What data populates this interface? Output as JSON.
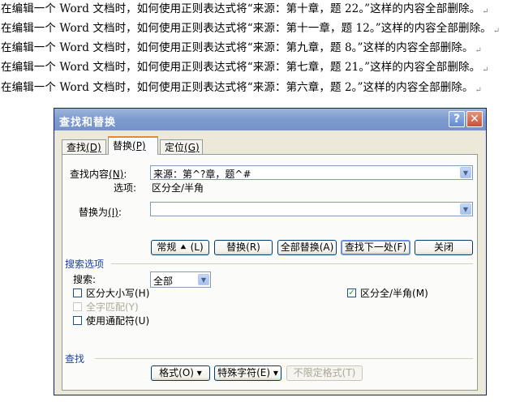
{
  "document": {
    "lines": [
      "在编辑一个 Word 文档时，如何使用正则表达式将“来源：第十章，题 22。”这样的内容全部删除。",
      "在编辑一个 Word 文档时，如何使用正则表达式将“来源：第十一章，题 12。”这样的内容全部删除。",
      "在编辑一个 Word 文档时，如何使用正则表达式将“来源：第九章，题 8。”这样的内容全部删除。",
      "在编辑一个 Word 文档时，如何使用正则表达式将“来源：第七章，题 21。”这样的内容全部删除。",
      "在编辑一个 Word 文档时，如何使用正则表达式将“来源：第六章，题 2。”这样的内容全部删除。"
    ],
    "paragraph_mark": "↵"
  },
  "dialog": {
    "title": "查找和替换",
    "help_glyph": "?",
    "close_glyph": "✕",
    "tabs": [
      {
        "label": "查找",
        "key": "(D)"
      },
      {
        "label": "替换",
        "key": "(P)"
      },
      {
        "label": "定位",
        "key": "(G)"
      }
    ],
    "find_label": "查找内容",
    "find_key": "(N)",
    "colon": ":",
    "find_value": "来源：第^?章，题^#",
    "options_label": "选项:",
    "options_value": "区分全/半角",
    "replace_label": "替换为",
    "replace_key": "(I)",
    "replace_value": "",
    "buttons": {
      "less": "常规 ⯅ (L)",
      "replace": "替换(R)",
      "replace_all": "全部替换(A)",
      "find_next": "查找下一处(F)",
      "close": "关闭"
    },
    "search_options_title": "搜索选项",
    "search_label": "搜索:",
    "search_value": "全部",
    "checkboxes": {
      "match_case": "区分大小写(H)",
      "whole_word": "全字匹配(Y)",
      "wildcards": "使用通配符(U)",
      "width": "区分全/半角(M)",
      "width_check": "✓"
    },
    "find_section_title": "查找",
    "bottom_buttons": {
      "format": "格式(O) ▾",
      "special": "特殊字符(E) ▾",
      "no_format": "不限定格式(T)"
    },
    "dropdown_glyph": "▼"
  }
}
